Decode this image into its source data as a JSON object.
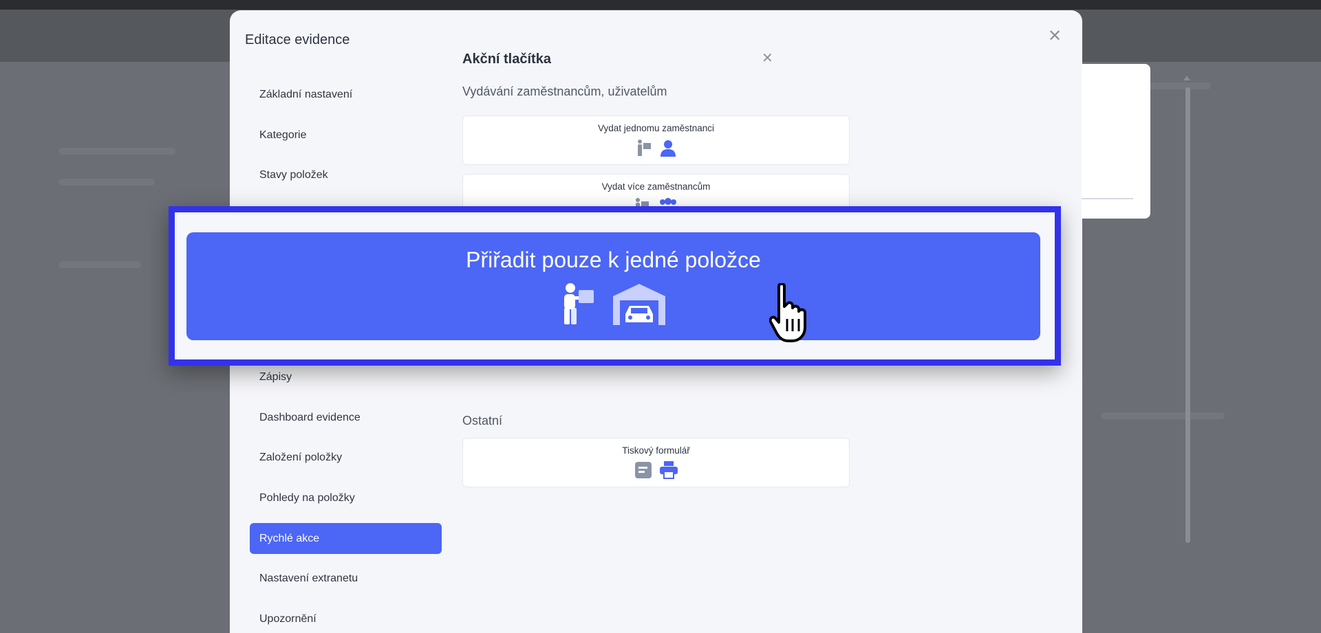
{
  "modal": {
    "title": "Editace evidence",
    "nav": [
      {
        "label": "Základní nastavení"
      },
      {
        "label": "Kategorie"
      },
      {
        "label": "Stavy položek"
      },
      {
        "label": ""
      },
      {
        "label": ""
      },
      {
        "label": ""
      },
      {
        "label": ""
      },
      {
        "label": "Zápisy"
      },
      {
        "label": "Dashboard evidence"
      },
      {
        "label": "Založení položky"
      },
      {
        "label": "Pohledy na položky"
      },
      {
        "label": "Rychlé akce"
      },
      {
        "label": "Nastavení extranetu"
      },
      {
        "label": "Upozornění"
      }
    ],
    "active_nav": "Rychlé akce"
  },
  "panel": {
    "title": "Akční tlačítka",
    "section_employees": "Vydávání zaměstnancům, uživatelům",
    "card_one": "Vydat jednomu zaměstnanci",
    "card_many": "Vydat více zaměstnancům",
    "section_other": "Ostatní",
    "card_print": "Tiskový formulář"
  },
  "zoom": {
    "button_label": "Přiřadit pouze k jedné položce"
  },
  "colors": {
    "accent": "#4c66f5",
    "callout_border": "#3232ee",
    "icon_muted": "#8b94a6"
  }
}
